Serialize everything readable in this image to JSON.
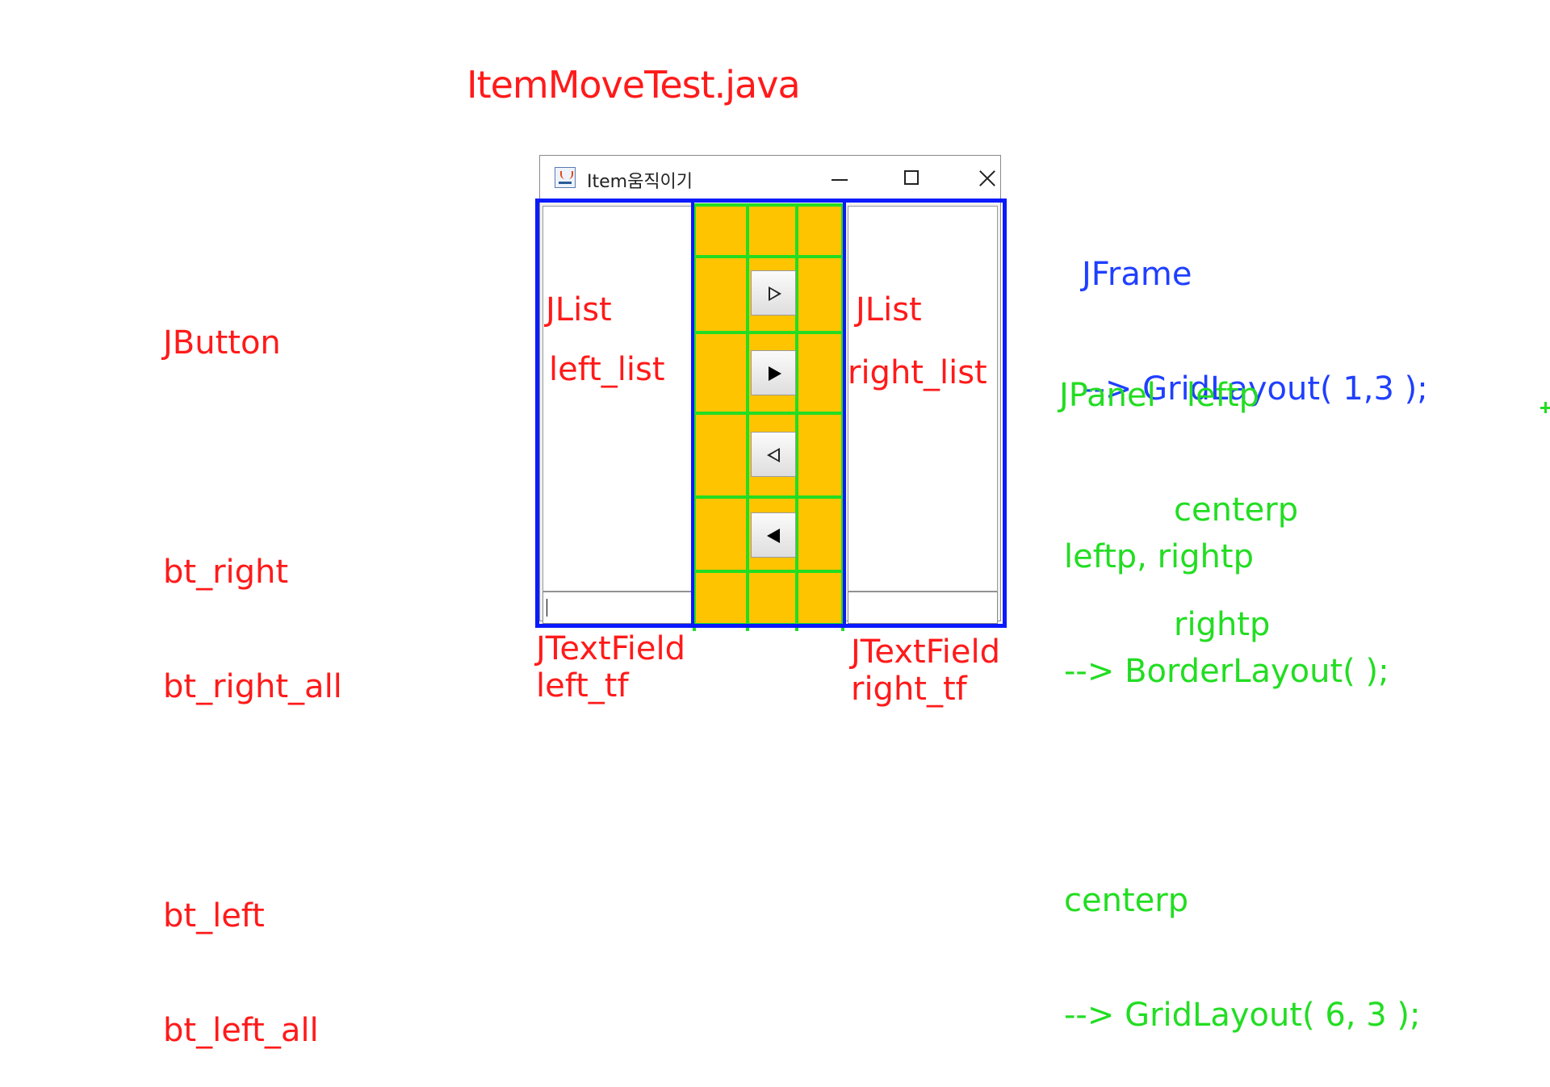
{
  "page_title": "ItemMoveTest.java",
  "window": {
    "title": "Item움직이기",
    "app_icon": "java-icon",
    "controls": {
      "minimize": "minimize-icon",
      "maximize": "maximize-icon",
      "close": "close-icon"
    }
  },
  "buttons": [
    {
      "name": "bt_right",
      "icon": "triangle-right-outline-icon"
    },
    {
      "name": "bt_right_all",
      "icon": "triangle-right-filled-icon"
    },
    {
      "name": "bt_left",
      "icon": "triangle-left-outline-icon"
    },
    {
      "name": "bt_left_all",
      "icon": "triangle-left-filled-icon"
    }
  ],
  "annotations": {
    "button_notes": {
      "heading": "JButton",
      "bt_right": "bt_right",
      "bt_right_all": "bt_right_all",
      "bt_left": "bt_left",
      "bt_left_all": "bt_left_all"
    },
    "left_list": {
      "type": "JList",
      "name": "left_list"
    },
    "right_list": {
      "type": "JList",
      "name": "right_list"
    },
    "left_tf": {
      "type": "JTextField",
      "name": "left_tf"
    },
    "right_tf": {
      "type": "JTextField",
      "name": "right_tf"
    },
    "jframe": {
      "line1": "JFrame",
      "line2": "--> GridLayout( 1,3 );"
    },
    "jpanel": {
      "label": "JPanel",
      "p1": "leftp",
      "p2": "centerp",
      "p3": "rightp"
    },
    "border_layout": {
      "line1": "leftp, rightp",
      "line2": "--> BorderLayout( );"
    },
    "grid_layout": {
      "line1": "centerp",
      "line2": "--> GridLayout( 6, 3 );"
    }
  },
  "colors": {
    "annotation_red": "#ff1a1a",
    "annotation_blue": "#1f3fff",
    "annotation_green": "#22dd22",
    "panel_outline": "#0a1aff",
    "center_fill": "#ffc400"
  }
}
